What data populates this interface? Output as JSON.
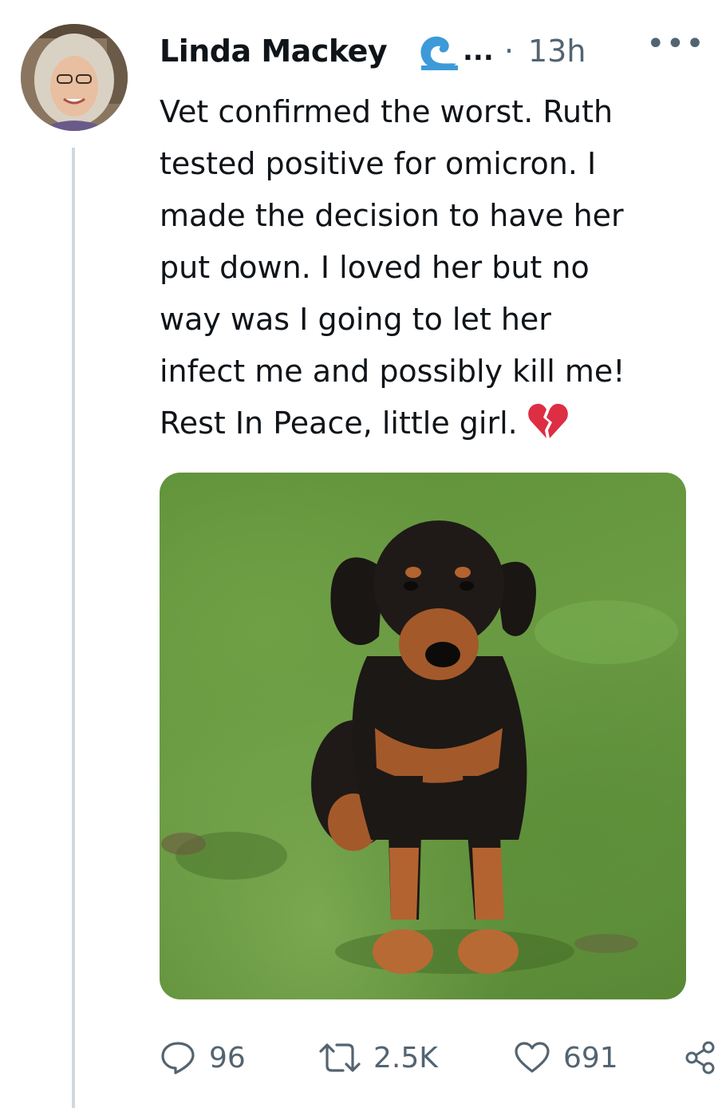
{
  "tweet": {
    "author_name": "Linda Mackey",
    "handle_truncated": "...",
    "separator": "·",
    "timestamp": "13h",
    "more_label": "•••",
    "text_lines": [
      "Vet confirmed the worst. Ruth",
      "tested positive for omicron. I",
      "made the decision to have her",
      "put down. I loved her but no",
      "way was I going to let her",
      "infect me and possibly kill me!",
      "Rest In Peace, little girl."
    ],
    "emoji": "broken-heart",
    "media": {
      "subject": "dog-photo"
    }
  },
  "actions": {
    "reply_count": "96",
    "retweet_count": "2.5K",
    "like_count": "691"
  },
  "colors": {
    "badge": "#3d9ad8",
    "muted": "#536471",
    "heart_emoji": "#dd2e44",
    "thread_line": "#cfd9de"
  }
}
